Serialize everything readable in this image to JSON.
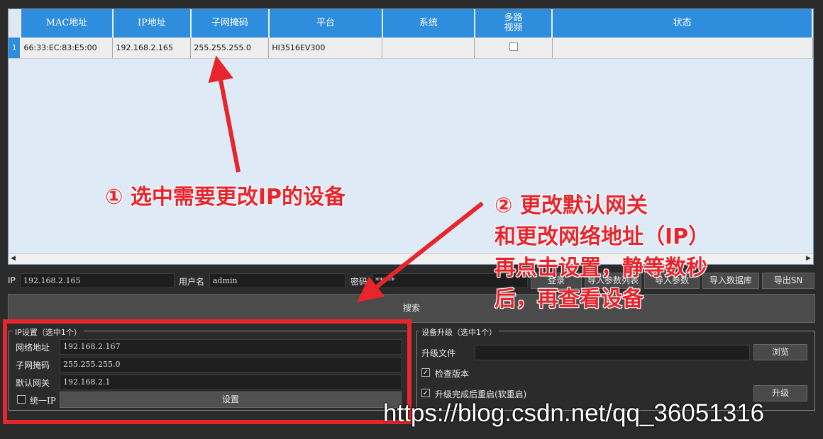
{
  "table": {
    "columns": [
      "MAC地址",
      "IP地址",
      "子网掩码",
      "平台",
      "系统",
      "多路\n视频",
      "状态"
    ],
    "rows": [
      {
        "num": "1",
        "mac": "66:33:EC:83:E5:00",
        "ip": "192.168.2.165",
        "mask": "255.255.255.0",
        "platform": "HI3516EV300",
        "system": "",
        "multi": false,
        "status": ""
      }
    ]
  },
  "login": {
    "ip_label": "IP",
    "ip_value": "192.168.2.165",
    "user_label": "用户名",
    "user_value": "admin",
    "pass_label": "密码",
    "pass_value": "*****",
    "btn_login": "登录",
    "btn_export_params": "导入参数列表",
    "btn_import_params": "导入参数",
    "btn_import_db": "导入数据库",
    "btn_export_sn": "导出SN"
  },
  "search_label": "搜索",
  "ipset": {
    "title": "IP设置（选中1个）",
    "addr_label": "网络地址",
    "addr_value": "192.168.2.167",
    "mask_label": "子网掩码",
    "mask_value": "255.255.255.0",
    "gw_label": "默认网关",
    "gw_value": "192.168.2.1",
    "unify_label": "统一IP",
    "set_button": "设置"
  },
  "upgrade": {
    "title": "设备升级（选中1个）",
    "file_label": "升级文件",
    "browse_button": "浏览",
    "check_version": "检查版本",
    "reboot_after": "升级完成后重启(软重启)",
    "upgrade_button": "升级"
  },
  "annotations": {
    "step1": "① 选中需要更改IP的设备",
    "step2_line1": "② 更改默认网关",
    "step2_line2": "和更改网络地址（IP）",
    "step2_line3": "再点击设置，静等数秒",
    "step2_line4": "后，再查看设备"
  },
  "watermark": "https://blog.csdn.net/qq_36051316",
  "colors": {
    "header_blue": "#2f8ddd",
    "annotation_red": "#e8242c",
    "panel_bg": "#2b2b2b"
  }
}
